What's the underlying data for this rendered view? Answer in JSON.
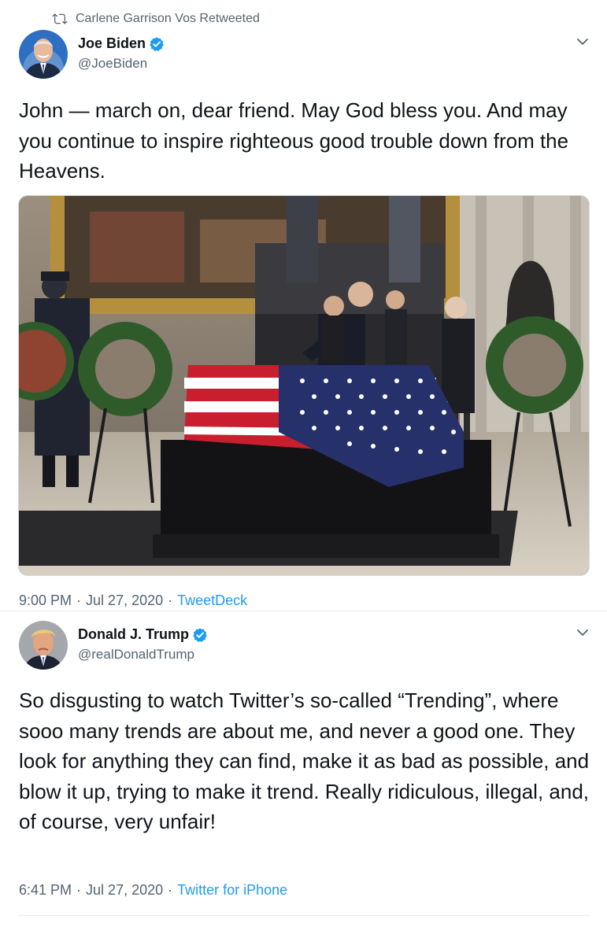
{
  "tweets": [
    {
      "retweet_label": "Carlene Garrison Vos Retweeted",
      "name": "Joe Biden",
      "handle": "@JoeBiden",
      "text": "John — march on, dear friend. May God bless you. And may you continue to inspire righteous good trouble down from the Heavens.",
      "time": "9:00 PM",
      "date": "Jul 27, 2020",
      "source": "TweetDeck",
      "has_media": true
    },
    {
      "name": "Donald J. Trump",
      "handle": "@realDonaldTrump",
      "text": "So disgusting to watch Twitter’s so-called “Trending”, where sooo many trends are about me, and never a good one. They look for anything they can find, make it as bad as possible, and blow it up, trying to make it trend. Really ridiculous, illegal, and, of course, very unfair!",
      "time": "6:41 PM",
      "date": "Jul 27, 2020",
      "source": "Twitter for iPhone"
    }
  ],
  "separator": "·",
  "colors": {
    "verified": "#1d9bf0",
    "link": "#1d9bf0",
    "secondary_text": "#536471"
  },
  "icons": [
    "retweet-icon",
    "verified-badge-icon",
    "chevron-down-icon"
  ]
}
